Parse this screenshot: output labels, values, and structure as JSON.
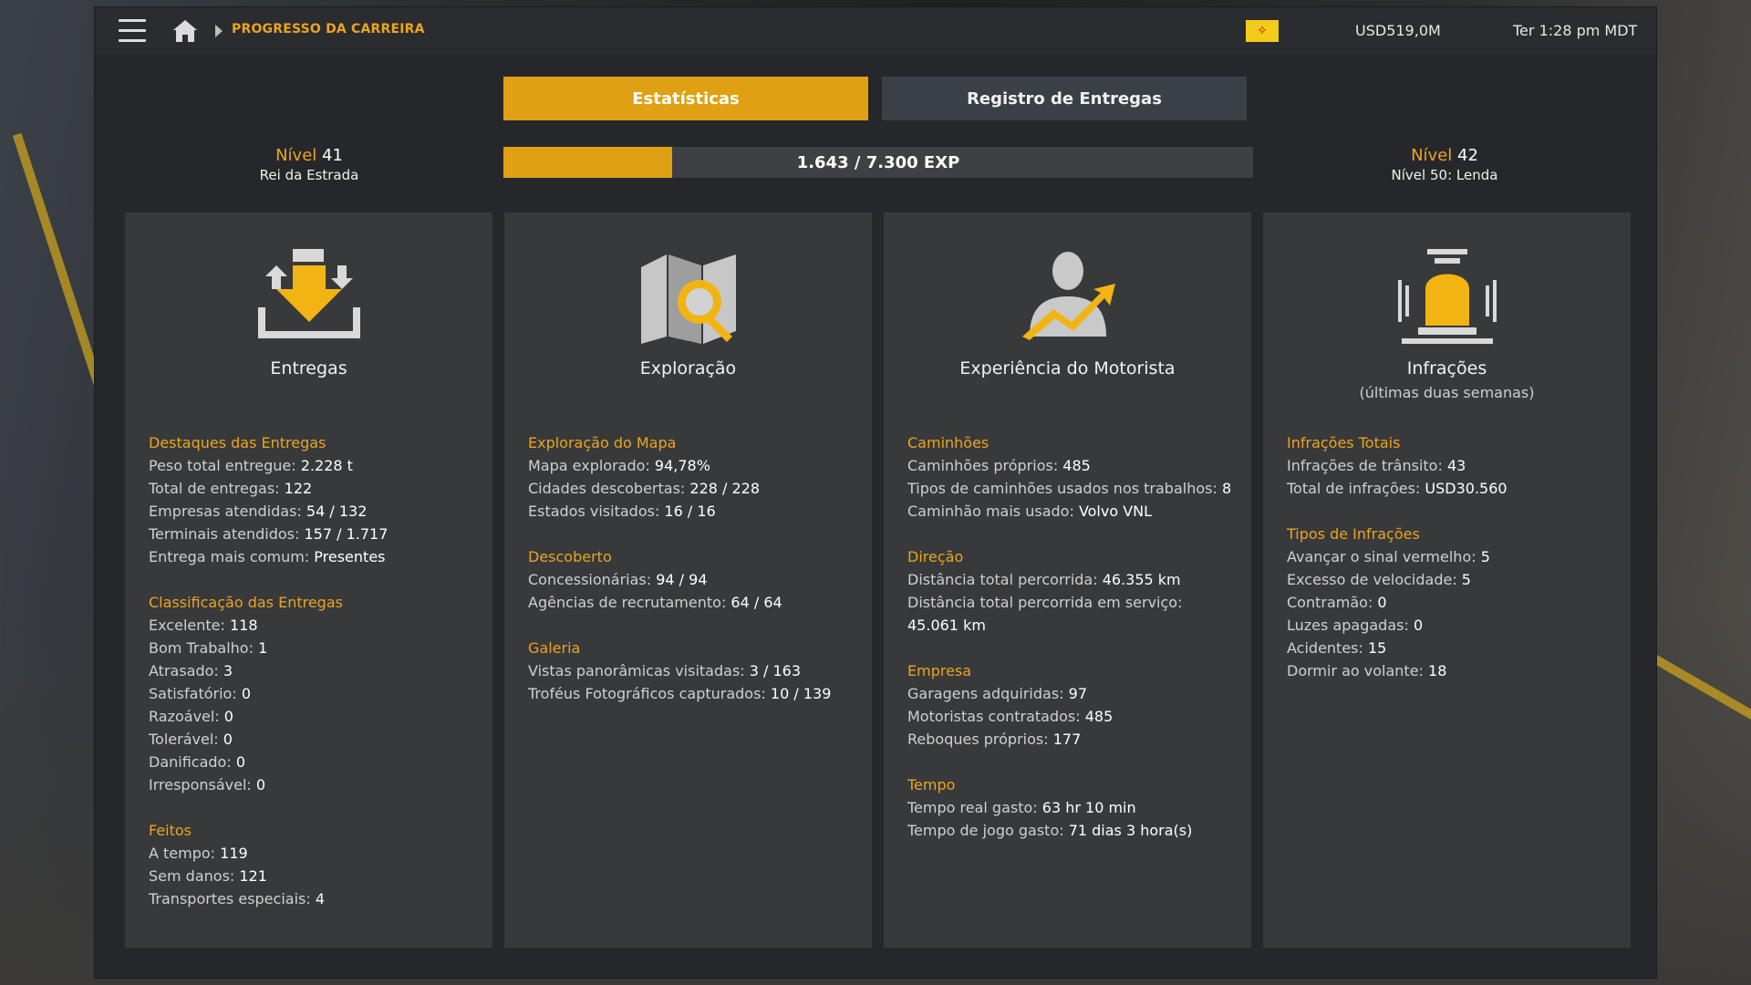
{
  "topbar": {
    "breadcrumb": "PROGRESSO DA CARREIRA",
    "money": "USD519,0M",
    "time": "Ter 1:28 pm MDT"
  },
  "tabs": {
    "stats": "Estatísticas",
    "deliveries_log": "Registro de Entregas"
  },
  "level_current": {
    "word": "Nível",
    "number": "41",
    "title": "Rei da Estrada"
  },
  "level_next": {
    "word": "Nível",
    "number": "42",
    "title": "Nível 50: Lenda"
  },
  "xp": {
    "text": "1.643 / 7.300 EXP",
    "fraction": 0.225
  },
  "panels": {
    "deliveries": {
      "title": "Entregas",
      "sections": [
        {
          "heading": "Destaques das Entregas",
          "rows": [
            {
              "label": "Peso total entregue: ",
              "value": "2.228 t"
            },
            {
              "label": "Total de entregas: ",
              "value": "122"
            },
            {
              "label": "Empresas atendidas: ",
              "value": "54 / 132"
            },
            {
              "label": "Terminais atendidos: ",
              "value": "157 / 1.717"
            },
            {
              "label": "Entrega mais comum: ",
              "value": "Presentes"
            }
          ]
        },
        {
          "heading": "Classificação das Entregas",
          "rows": [
            {
              "label": "Excelente: ",
              "value": "118"
            },
            {
              "label": "Bom Trabalho: ",
              "value": "1"
            },
            {
              "label": "Atrasado: ",
              "value": "3"
            },
            {
              "label": "Satisfatório: ",
              "value": "0"
            },
            {
              "label": "Razoável: ",
              "value": "0"
            },
            {
              "label": "Tolerável: ",
              "value": "0"
            },
            {
              "label": "Danificado: ",
              "value": "0"
            },
            {
              "label": "Irresponsável: ",
              "value": "0"
            }
          ]
        },
        {
          "heading": "Feitos",
          "rows": [
            {
              "label": "A tempo: ",
              "value": "119"
            },
            {
              "label": "Sem danos: ",
              "value": "121"
            },
            {
              "label": "Transportes especiais: ",
              "value": "4"
            }
          ]
        }
      ]
    },
    "exploration": {
      "title": "Exploração",
      "sections": [
        {
          "heading": "Exploração do Mapa",
          "rows": [
            {
              "label": "Mapa explorado: ",
              "value": "94,78%"
            },
            {
              "label": "Cidades descobertas: ",
              "value": "228 / 228"
            },
            {
              "label": "Estados visitados: ",
              "value": "16 / 16"
            }
          ]
        },
        {
          "heading": "Descoberto",
          "rows": [
            {
              "label": "Concessionárias: ",
              "value": "94 / 94"
            },
            {
              "label": "Agências de recrutamento: ",
              "value": "64 / 64"
            }
          ]
        },
        {
          "heading": "Galeria",
          "rows": [
            {
              "label": "Vistas panorâmicas visitadas: ",
              "value": "3 / 163"
            },
            {
              "label": "Troféus Fotográficos capturados: ",
              "value": "10 / 139"
            }
          ]
        }
      ]
    },
    "driver": {
      "title": "Experiência do Motorista",
      "sections": [
        {
          "heading": "Caminhões",
          "rows": [
            {
              "label": "Caminhões próprios: ",
              "value": "485"
            },
            {
              "label": "Tipos de caminhões usados nos trabalhos: ",
              "value": "8"
            },
            {
              "label": "Caminhão mais usado: ",
              "value": "Volvo VNL"
            }
          ]
        },
        {
          "heading": "Direção",
          "rows": [
            {
              "label": "Distância total percorrida: ",
              "value": "46.355 km"
            },
            {
              "label": "Distância total percorrida em serviço: ",
              "value": "45.061 km"
            }
          ]
        },
        {
          "heading": "Empresa",
          "rows": [
            {
              "label": "Garagens adquiridas: ",
              "value": "97"
            },
            {
              "label": "Motoristas contratados: ",
              "value": "485"
            },
            {
              "label": "Reboques próprios: ",
              "value": "177"
            }
          ]
        },
        {
          "heading": "Tempo",
          "rows": [
            {
              "label": "Tempo real gasto: ",
              "value": "63 hr 10 min"
            },
            {
              "label": "Tempo de jogo gasto: ",
              "value": "71 dias 3 hora(s)"
            }
          ]
        }
      ]
    },
    "offences": {
      "title": "Infrações",
      "subtitle": "(últimas duas semanas)",
      "sections": [
        {
          "heading": "Infrações Totais",
          "rows": [
            {
              "label": "Infrações de trânsito: ",
              "value": "43"
            },
            {
              "label": "Total de infrações: ",
              "value": "USD30.560"
            }
          ]
        },
        {
          "heading": "Tipos de Infrações",
          "rows": [
            {
              "label": "Avançar o sinal vermelho: ",
              "value": "5"
            },
            {
              "label": "Excesso de velocidade: ",
              "value": "5"
            },
            {
              "label": "Contramão: ",
              "value": "0"
            },
            {
              "label": "Luzes apagadas: ",
              "value": "0"
            },
            {
              "label": "Acidentes: ",
              "value": "15"
            },
            {
              "label": "Dormir ao volante: ",
              "value": "18"
            }
          ]
        }
      ]
    }
  },
  "colors": {
    "accent": "#e0a013",
    "panel": "#38393b",
    "tab_inactive": "#3a4046"
  },
  "icons": [
    "menu-icon",
    "home-icon",
    "state-flag-icon",
    "deliveries-icon",
    "map-search-icon",
    "driver-growth-icon",
    "siren-icon"
  ]
}
